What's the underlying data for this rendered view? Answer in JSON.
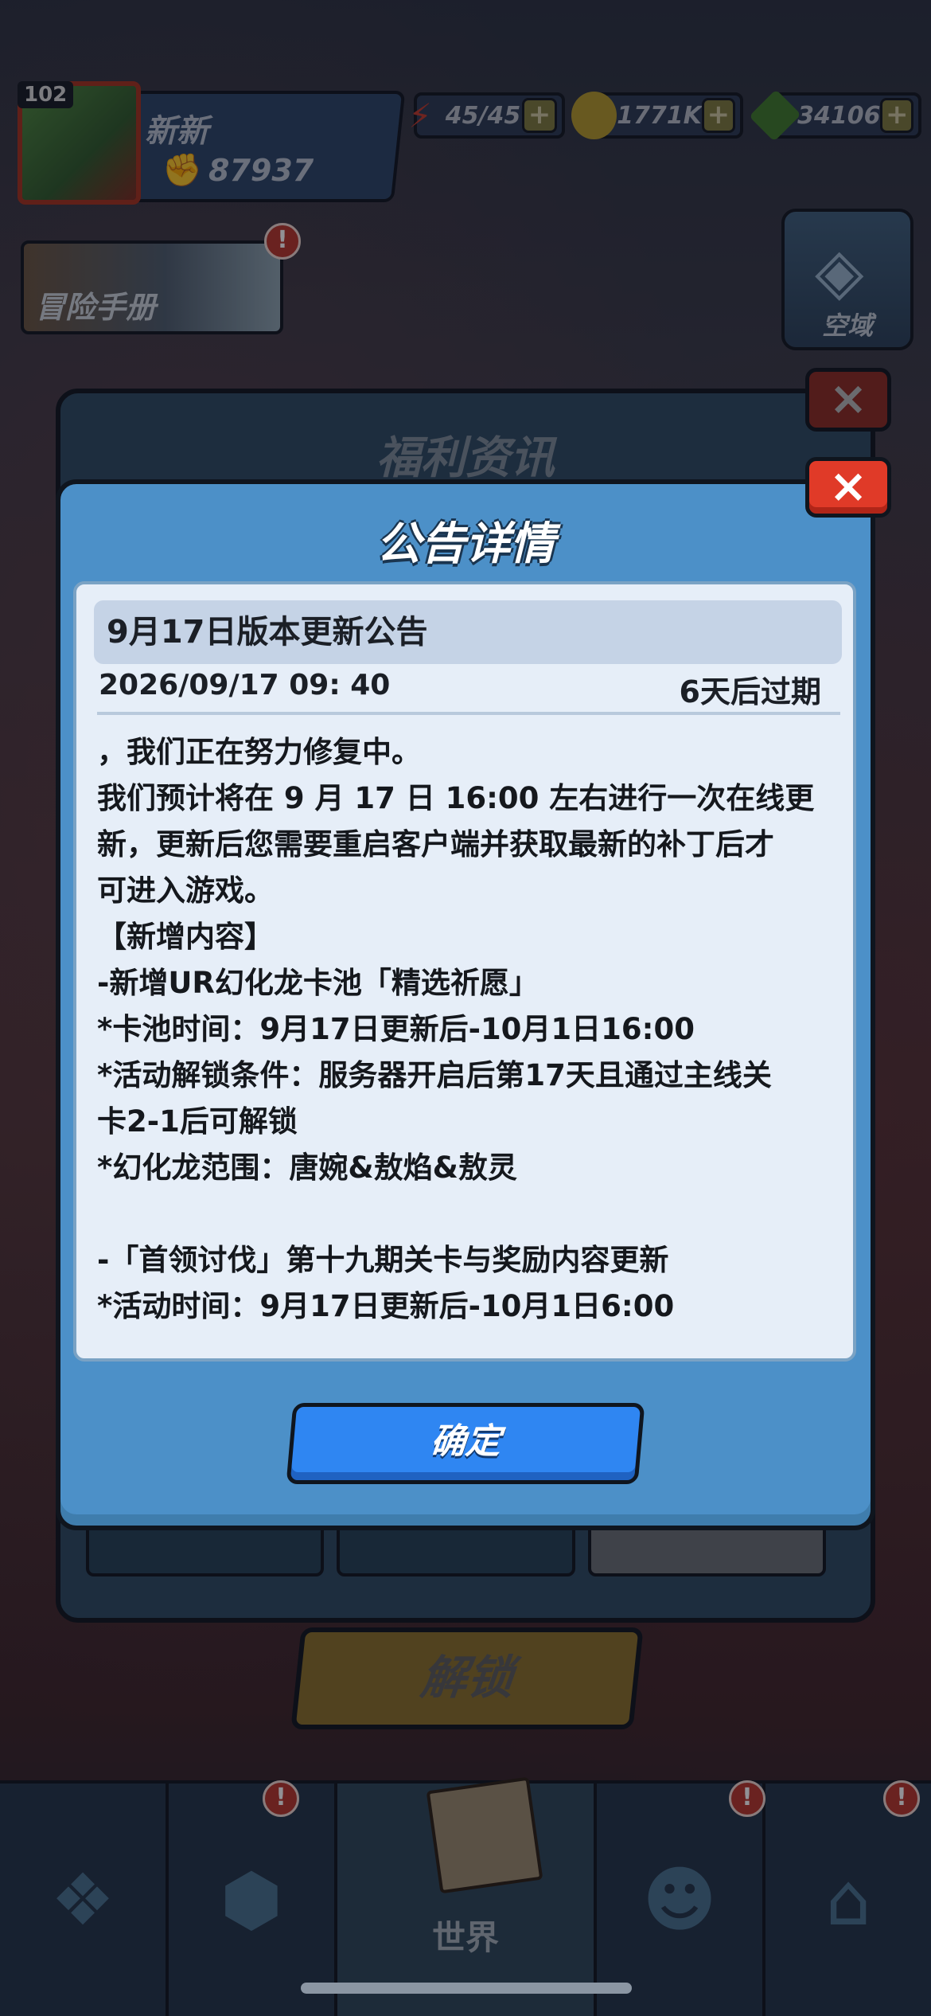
{
  "hud": {
    "level": "102",
    "player_name": "新新",
    "power": "87937",
    "energy": "45/45",
    "coins": "1771K",
    "gems": "34106",
    "plus": "+"
  },
  "side": {
    "adventure_book": "冒险手册",
    "airspace": "空域",
    "badge": "!"
  },
  "back_panel": {
    "title": "福利资讯",
    "close": "×",
    "unlock": "解锁"
  },
  "bottom_nav": {
    "world": "世界"
  },
  "dialog": {
    "title": "公告详情",
    "close": "×",
    "confirm": "确定",
    "announcement": {
      "title": "9月17日版本更新公告",
      "date": "2026/09/17 09: 40",
      "expire": "6天后过期",
      "lines": [
        "，我们正在努力修复中。",
        "我们预计将在 9 月 17 日 16:00 左右进行一次在线更",
        "新，更新后您需要重启客户端并获取最新的补丁后才",
        "可进入游戏。",
        "【新增内容】",
        "-新增UR幻化龙卡池「精选祈愿」",
        "*卡池时间：9月17日更新后-10月1日16:00",
        "*活动解锁条件：服务器开启后第17天且通过主线关",
        "卡2-1后可解锁",
        "*幻化龙范围：唐婉&敖焰&敖灵",
        "",
        "-「首领讨伐」第十九期关卡与奖励内容更新",
        "*活动时间：9月17日更新后-10月1日6:00"
      ]
    }
  },
  "colors": {
    "dialog_bg": "#4c90c8",
    "card_bg": "#e6eef8",
    "confirm_btn": "#2f86f2",
    "close_btn": "#e03a28"
  }
}
